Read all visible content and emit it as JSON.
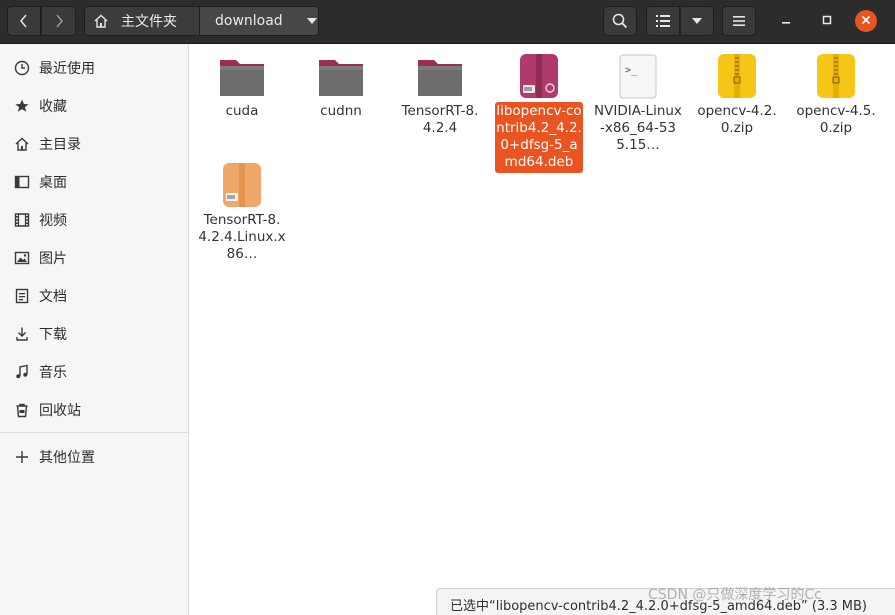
{
  "header": {
    "path": [
      {
        "label": "主文件夹",
        "icon": "home-icon"
      },
      {
        "label": "download",
        "icon": "chevron-down-icon"
      }
    ],
    "buttons": {
      "back": "chevron-left-icon",
      "forward": "chevron-right-icon",
      "search": "search-icon",
      "view_list": "list-view-icon",
      "view_options": "caret-down-icon",
      "menu": "hamburger-icon"
    },
    "window_controls": [
      "minimize-icon",
      "maximize-icon",
      "close-icon"
    ]
  },
  "sidebar": {
    "items": [
      {
        "label": "最近使用",
        "icon": "clock-icon"
      },
      {
        "label": "收藏",
        "icon": "star-icon"
      },
      {
        "label": "主目录",
        "icon": "home-icon"
      },
      {
        "label": "桌面",
        "icon": "desktop-icon"
      },
      {
        "label": "视频",
        "icon": "video-icon"
      },
      {
        "label": "图片",
        "icon": "picture-icon"
      },
      {
        "label": "文档",
        "icon": "document-icon"
      },
      {
        "label": "下载",
        "icon": "download-icon"
      },
      {
        "label": "音乐",
        "icon": "music-icon"
      },
      {
        "label": "回收站",
        "icon": "trash-icon"
      }
    ],
    "other": {
      "label": "其他位置",
      "icon": "plus-icon"
    }
  },
  "files": [
    {
      "name": "cuda",
      "type": "folder"
    },
    {
      "name": "cudnn",
      "type": "folder"
    },
    {
      "name": "TensorRT-8.4.2.4",
      "type": "folder"
    },
    {
      "name": "libopencv-contrib4.2_4.2.0+dfsg-5_amd64.deb",
      "type": "deb",
      "selected": true
    },
    {
      "name": "NVIDIA-Linux-x86_64-535.15…",
      "type": "script"
    },
    {
      "name": "opencv-4.2.0.zip",
      "type": "zip"
    },
    {
      "name": "opencv-4.5.0.zip",
      "type": "zip"
    },
    {
      "name": "TensorRT-8.4.2.4.Linux.x86…",
      "type": "archive"
    }
  ],
  "status": {
    "text": "已选中“libopencv-contrib4.2_4.2.0+dfsg-5_amd64.deb” (3.3 MB)"
  },
  "watermark": "CSDN @只做深度学习的Cc",
  "colors": {
    "accent": "#e95420",
    "headerbar": "#2c2c2c",
    "folder": "#6d6d6d",
    "folder_tab": "#9b2e52",
    "deb": "#b03a6b",
    "zip": "#f5c518"
  }
}
